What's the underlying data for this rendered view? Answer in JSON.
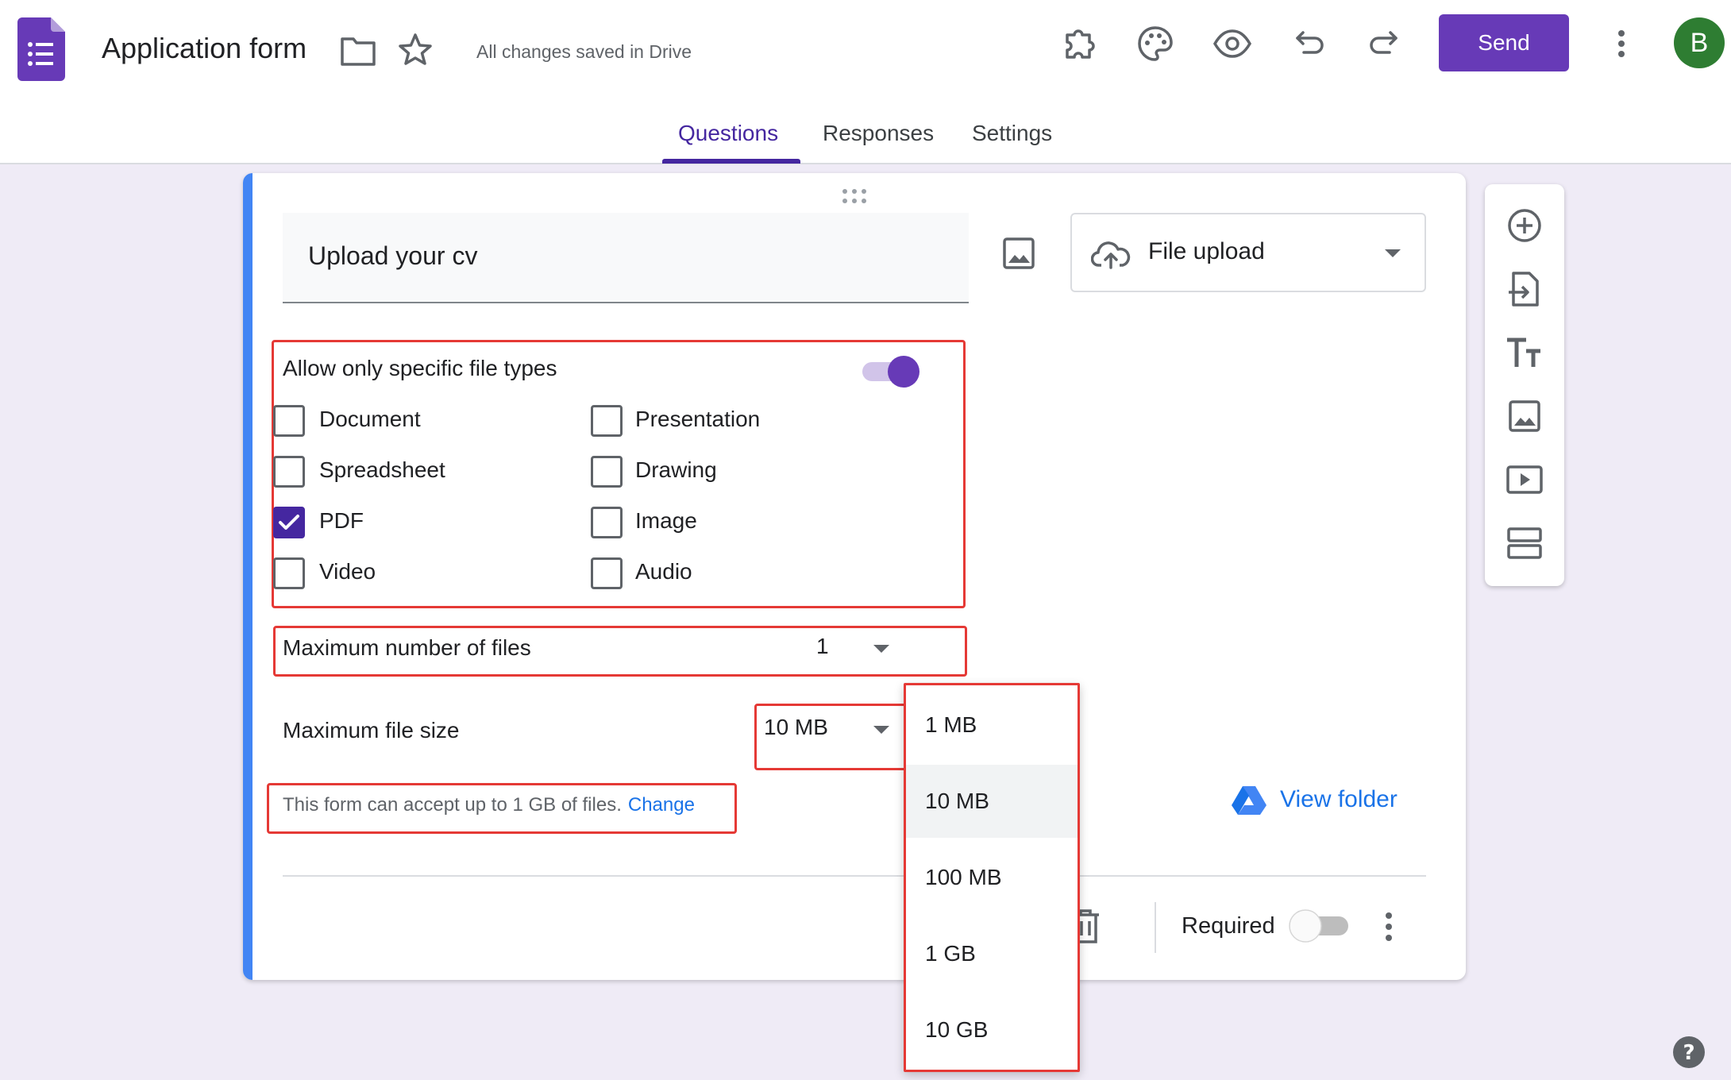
{
  "header": {
    "title": "Application form",
    "save_status": "All changes saved in Drive",
    "send_label": "Send",
    "avatar_letter": "B",
    "icons": [
      "forms-logo-icon",
      "folder-icon",
      "star-icon",
      "addons-icon",
      "palette-icon",
      "preview-icon",
      "undo-icon",
      "redo-icon",
      "more-vert-icon"
    ]
  },
  "tabs": [
    {
      "label": "Questions",
      "active": true
    },
    {
      "label": "Responses",
      "active": false
    },
    {
      "label": "Settings",
      "active": false
    }
  ],
  "question": {
    "title": "Upload your cv",
    "type_label": "File upload",
    "file_types": {
      "label": "Allow only specific file types",
      "enabled": true,
      "options": [
        {
          "label": "Document",
          "checked": false
        },
        {
          "label": "Presentation",
          "checked": false
        },
        {
          "label": "Spreadsheet",
          "checked": false
        },
        {
          "label": "Drawing",
          "checked": false
        },
        {
          "label": "PDF",
          "checked": true
        },
        {
          "label": "Image",
          "checked": false
        },
        {
          "label": "Video",
          "checked": false
        },
        {
          "label": "Audio",
          "checked": false
        }
      ]
    },
    "max_files": {
      "label": "Maximum number of files",
      "value": "1"
    },
    "max_size": {
      "label": "Maximum file size",
      "value": "10 MB"
    },
    "limit_note": {
      "text": "This form can accept up to 1 GB of files.",
      "link": "Change"
    },
    "view_folder": "View folder",
    "required_label": "Required",
    "required": false
  },
  "size_menu": {
    "options": [
      "1 MB",
      "10 MB",
      "100 MB",
      "1 GB",
      "10 GB"
    ],
    "selected": "10 MB"
  },
  "colors": {
    "accent": "#673ab7",
    "tab_active": "#4527a0",
    "card_accent": "#4285f4",
    "highlight": "#e53935",
    "link": "#1a73e8",
    "page_bg": "#efebf6"
  }
}
